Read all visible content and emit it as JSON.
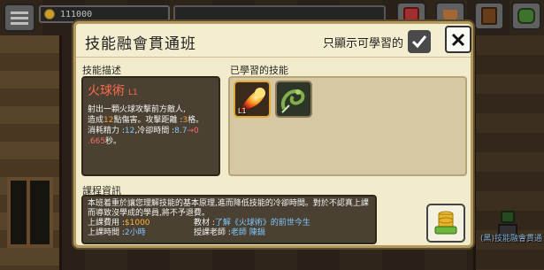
{
  "hud": {
    "gold": "111000",
    "colors": {
      "coin": "#f3c23a",
      "trophy": "#c87d3e"
    },
    "icons": [
      "menu-icon",
      "coin-icon",
      "shield-icon",
      "trophy-icon",
      "book-icon",
      "pet-icon"
    ]
  },
  "modal": {
    "title": "技能融會貫通班",
    "filter_label": "只顯示可學習的",
    "filter_checked": true,
    "close_icon": "close-icon"
  },
  "skill_description": {
    "section_label": "技能描述",
    "name": "火球術",
    "level": "L1",
    "text": {
      "line1": "射出一顆火球攻擊前方敵人,",
      "t_dmg_pre": "造成",
      "dmg": "12",
      "t_dmg_post": "點傷害。攻擊距離 :",
      "range": "3",
      "t_range_post": "格。",
      "t_mp_pre": "消耗精力 :",
      "mp": "12",
      "t_cd_label": ",冷卻時間 :",
      "cd": "8.7",
      "arrow": "→",
      "cd_next": "0",
      "cd_next2": ".665",
      "t_cd_post": "秒。"
    }
  },
  "learned_skills": {
    "section_label": "已學習的技能",
    "skills": [
      {
        "name": "fireball-skill-icon",
        "level": "L1"
      },
      {
        "name": "serpent-skill-icon",
        "level": ""
      }
    ]
  },
  "course_info": {
    "section_label": "課程資訊",
    "text": "本班着重於讓您理解技能的基本原理,進而降低技能的冷卻時間。對於不認真上課而導致沒學成的學員,將不予退費。",
    "fee_label": "上課費用 :",
    "fee": "$1000",
    "material_label": "教材 :",
    "material": "了解《火球術》的前世今生",
    "time_label": "上課時間 :",
    "time": "2小時",
    "teacher_label": "授課老師 :",
    "teacher": "老師 陳鍋"
  },
  "npc_label": "(黑)技能融會貫通",
  "colors": {
    "modal_bg": "#f2eccc",
    "panel_dark": "#4a4133",
    "skill_name": "#ff6a4a",
    "highlight_orange": "#ff9a3a",
    "highlight_blue": "#7fc7ff"
  }
}
